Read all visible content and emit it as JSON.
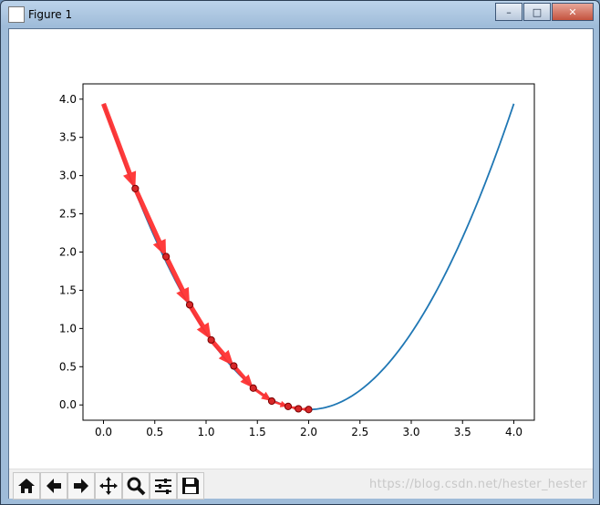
{
  "window": {
    "title": "Figure 1",
    "min_label": "–",
    "max_label": "□",
    "close_label": "✕"
  },
  "toolbar": {
    "buttons": [
      "home-icon",
      "back-arrow-icon",
      "forward-arrow-icon",
      "pan-icon",
      "zoom-icon",
      "configure-subplots-icon",
      "save-icon"
    ]
  },
  "watermark": "https://blog.csdn.net/hester_hester",
  "colors": {
    "curve": "#1f77b4",
    "arrow": "#ff3030",
    "point": "#d62728",
    "outline": "#7a0000"
  },
  "chart_data": {
    "type": "line",
    "title": "",
    "xlabel": "",
    "ylabel": "",
    "xlim": [
      -0.2,
      4.2
    ],
    "ylim": [
      -0.2,
      4.2
    ],
    "xticks": [
      "0.0",
      "0.5",
      "1.0",
      "1.5",
      "2.0",
      "2.5",
      "3.0",
      "3.5",
      "4.0"
    ],
    "yticks": [
      "0.0",
      "0.5",
      "1.0",
      "1.5",
      "2.0",
      "2.5",
      "3.0",
      "3.5",
      "4.0"
    ],
    "series": [
      {
        "function": "(x-2)^2 - 0.06",
        "x_range": [
          0,
          4
        ]
      },
      {
        "points_x": [
          0.0,
          0.31,
          0.61,
          0.84,
          1.05,
          1.27,
          1.46,
          1.64,
          1.8,
          1.9,
          2.0
        ],
        "points_y": [
          3.94,
          2.83,
          1.94,
          1.31,
          0.85,
          0.51,
          0.22,
          0.05,
          -0.02,
          -0.05,
          -0.06
        ]
      }
    ]
  }
}
